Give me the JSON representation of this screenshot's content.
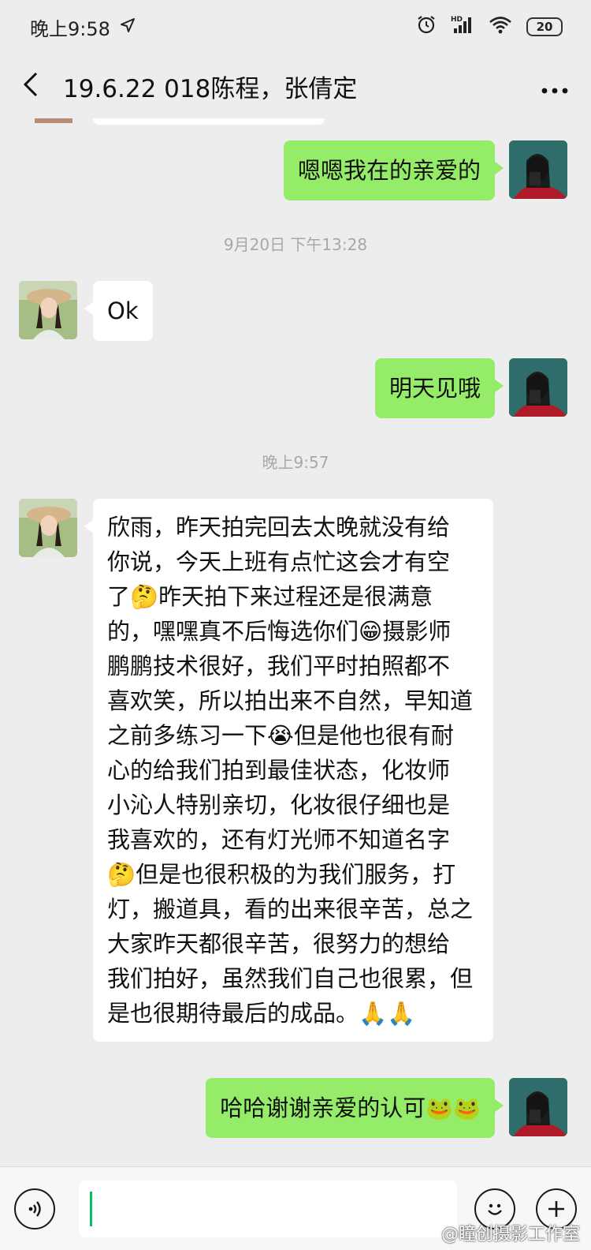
{
  "status_bar": {
    "time": "晚上9:58",
    "battery": "20",
    "location_icon": "location-arrow-icon",
    "alarm_icon": "alarm-icon",
    "signal_icon": "hd-signal-icon",
    "wifi_icon": "wifi-icon"
  },
  "header": {
    "back_icon": "chevron-left-icon",
    "title": "19.6.22 018陈程，张倩定",
    "more_icon": "more-dots-icon"
  },
  "messages": [
    {
      "type": "outgoing",
      "text": "嗯嗯我在的亲爱的"
    },
    {
      "type": "timestamp",
      "text": "9月20日 下午13:28"
    },
    {
      "type": "incoming",
      "text": "Ok"
    },
    {
      "type": "outgoing",
      "text": "明天见哦"
    },
    {
      "type": "timestamp",
      "text": "晚上9:57"
    },
    {
      "type": "incoming",
      "lines": [
        "欣雨，昨天拍完回去太晚就没有给",
        "你说，今天上班有点忙这会才有空",
        "了🤔昨天拍下来过程还是很满意",
        "的，嘿嘿真不后悔选你们😁摄影师",
        "鹏鹏技术很好，我们平时拍照都不",
        "喜欢笑，所以拍出来不自然，早知道",
        "之前多练习一下😭但是他也很有耐",
        "心的给我们拍到最佳状态，化妆师",
        "小沁人特别亲切，化妆很仔细也是",
        "我喜欢的，还有灯光师不知道名字",
        "🤔但是也很积极的为我们服务，打",
        "灯，搬道具，看的出来很辛苦，总之",
        "大家昨天都很辛苦，很努力的想给",
        "我们拍好，虽然我们自己也很累，但",
        "是也很期待最后的成品。🙏🙏"
      ]
    },
    {
      "type": "outgoing",
      "text": "哈哈谢谢亲爱的认可",
      "emojis": "🐸🐸"
    }
  ],
  "input_bar": {
    "voice_icon": "voice-icon",
    "emoji_icon": "emoji-smile-icon",
    "add_icon": "plus-circle-icon"
  },
  "watermark": "@瞳创摄影工作室",
  "colors": {
    "background": "#ededed",
    "outgoing_bubble": "#95ec69",
    "incoming_bubble": "#ffffff",
    "accent": "#07c160"
  }
}
